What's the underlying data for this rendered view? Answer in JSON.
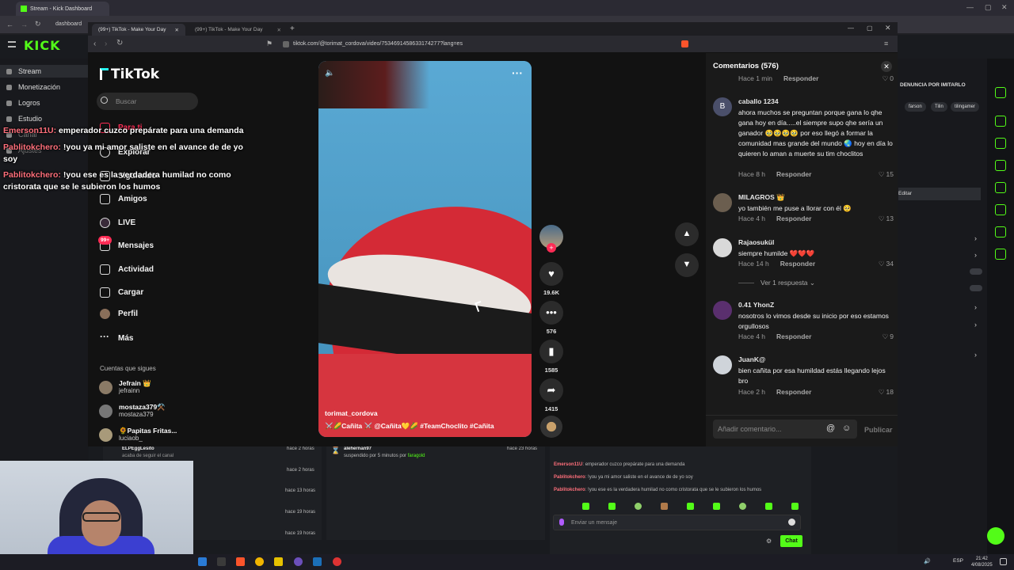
{
  "outer_browser": {
    "tab_title": "Stream - Kick Dashboard",
    "address_hint": "dashboard"
  },
  "kick": {
    "logo": "KICK",
    "nav": [
      {
        "label": "Stream"
      },
      {
        "label": "Monetización"
      },
      {
        "label": "Logros"
      },
      {
        "label": "Estudio"
      },
      {
        "label": "Canal"
      },
      {
        "label": "Ajustes"
      }
    ],
    "right_panel": {
      "report_text": "DENUNCIA POR IMITARLO",
      "chips": [
        "farson",
        "Tilin",
        "tilingamer"
      ],
      "edit_label": "Editar"
    },
    "activity": [
      {
        "user": "ELPEggLesito",
        "action": "acaba de seguir el canal",
        "time": "hace 2 horas"
      },
      {
        "user": "",
        "action": "",
        "time": "hace 2 horas"
      },
      {
        "user": "",
        "action": "",
        "time": "hace 13 horas"
      },
      {
        "user": "",
        "action": "",
        "time": "hace 19 horas"
      },
      {
        "user": "",
        "action": "",
        "time": "hace 19 horas"
      }
    ],
    "mod_event": {
      "user": "alehernan97",
      "action": "suspendido por 5 minutos por",
      "by": "faragold",
      "time": "hace 23 horas"
    },
    "mini_chat": [
      {
        "user": "Emerson11U",
        "text": "emperador cuzco prepárate para una demanda"
      },
      {
        "user": "Pablitokchero",
        "text": "!you ya mi amor saliste en el avance de de yo soy"
      },
      {
        "user": "Pablitokchero",
        "text": "!you ese es la verdadera humilad no como cristorata que se le subieron los humos"
      }
    ],
    "chat_placeholder": "Enviar un mensaje",
    "chat_button": "Chat"
  },
  "taskbar": {
    "time": "21:42",
    "date": "4/08/2025",
    "lang": "ESP"
  },
  "tiktok": {
    "tabs": [
      {
        "label": "(99+) TikTok - Make Your Day"
      },
      {
        "label": "(99+) TikTok - Make Your Day"
      }
    ],
    "url": "tiktok.com/@torimat_cordova/video/7534691458633174277?lang=es",
    "logo": "TikTok",
    "search_placeholder": "Buscar",
    "nav": [
      {
        "label": "Para ti"
      },
      {
        "label": "Explorar"
      },
      {
        "label": "Siguiendo"
      },
      {
        "label": "Amigos"
      },
      {
        "label": "LIVE"
      },
      {
        "label": "Mensajes"
      },
      {
        "label": "Actividad"
      },
      {
        "label": "Cargar"
      },
      {
        "label": "Perfil"
      },
      {
        "label": "Más"
      }
    ],
    "messages_badge": "99+",
    "following_title": "Cuentas que sigues",
    "following": [
      {
        "name": "Jefrain 👑",
        "handle": "jefrainn"
      },
      {
        "name": "mostaza379⚒️",
        "handle": "mostaza379"
      },
      {
        "name": "🌻Papitas Fritas...",
        "handle": "luciaob_"
      }
    ],
    "video": {
      "username": "torimat_cordova",
      "caption": "⚔️🌽Cañita ⚔️ @Cañita💛🌽 #TeamChoclito #Cañita"
    },
    "actions": {
      "likes": "19.6K",
      "comments": "576",
      "saves": "1585",
      "shares": "1415"
    },
    "comments_panel": {
      "title": "Comentarios (576)",
      "reply_label": "Responder",
      "top_meta": {
        "time": "Hace 1 min",
        "likes": "0"
      },
      "view_replies": "Ver 1 respuesta",
      "input_placeholder": "Añadir comentario...",
      "post_label": "Publicar",
      "comments": [
        {
          "avatar": "B",
          "user": "caballo 1234",
          "text": "ahora muchos se preguntan porque gana lo qhe gana hoy en día.....el siempre supo qhe sería un ganador 🥹🥹🥹🥹 por eso llegó a formar la comunidad mas grande del mundo 🌏 hoy en día lo quieren lo aman a muerte su tim choclitos",
          "time": "Hace 8 h",
          "likes": "15"
        },
        {
          "avatar": "",
          "user": "MILAGROS 👑",
          "text": "yo también me puse a llorar con él 🥺",
          "time": "Hace 4 h",
          "likes": "13"
        },
        {
          "avatar": "",
          "user": "Rajaosukül",
          "text": "siempre humilde ❤️❤️❤️",
          "time": "Hace 14 h",
          "likes": "34"
        },
        {
          "avatar": "",
          "user": "0.41 YhonZ",
          "text": "nosotros lo vimos desde su inicio por eso estamos orgullosos",
          "time": "Hace 4 h",
          "likes": "9"
        },
        {
          "avatar": "",
          "user": "JuanK@",
          "text": "bien cañita por esa humildad estás llegando lejos bro",
          "time": "Hace 2 h",
          "likes": "18"
        }
      ]
    }
  },
  "overlay_chat": [
    {
      "user": "Emerson11U:",
      "text": " emperador cuzco prepárate para una demanda"
    },
    {
      "user": "Pablitokchero:",
      "text": " !you ya mi amor saliste en el avance de de yo soy"
    },
    {
      "user": "Pablitokchero:",
      "text": " !you ese es la verdadera humilad no como cristorata que se le subieron los humos"
    }
  ],
  "colors": {
    "kick_green": "#53fc18",
    "tiktok_red": "#fe2c55",
    "overlay_user": "#ff6f7b"
  }
}
